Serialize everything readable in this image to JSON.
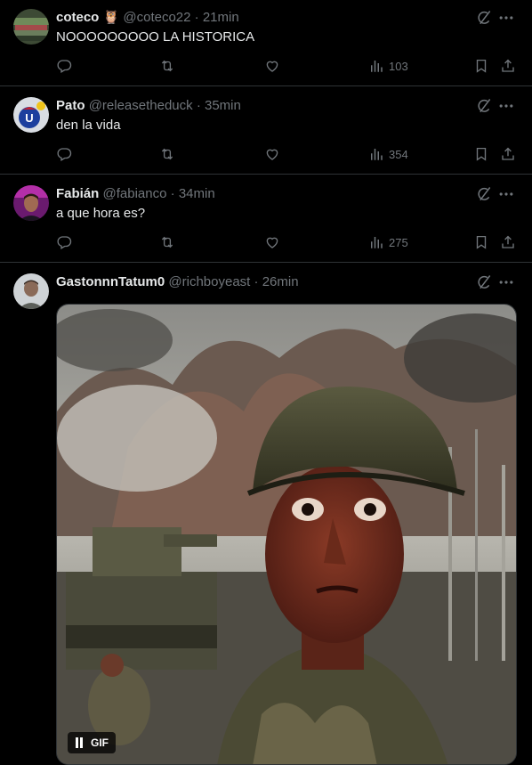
{
  "tweets": [
    {
      "name": "coteco",
      "emoji": "🦉",
      "handle": "@coteco22",
      "sep": "·",
      "time": "21min",
      "text": "NOOOOOOOOO LA HISTORICA",
      "views": "103"
    },
    {
      "name": "Pato",
      "handle": "@releasetheduck",
      "sep": "·",
      "time": "35min",
      "text": "den la vida",
      "views": "354"
    },
    {
      "name": "Fabián",
      "handle": "@fabianco",
      "sep": "·",
      "time": "34min",
      "text": "a que hora es?",
      "views": "275"
    },
    {
      "name": "GastonnnTatum0",
      "handle": "@richboyeast",
      "sep": "·",
      "time": "26min",
      "text": "",
      "media_label": "GIF"
    }
  ],
  "colors": {
    "background": "#000000",
    "text": "#e7e9ea",
    "muted": "#71767b",
    "divider": "#2f3336"
  },
  "icons": [
    "reply-icon",
    "retweet-icon",
    "like-icon",
    "views-icon",
    "bookmark-icon",
    "share-icon",
    "grok-icon",
    "more-icon",
    "pause-icon"
  ]
}
